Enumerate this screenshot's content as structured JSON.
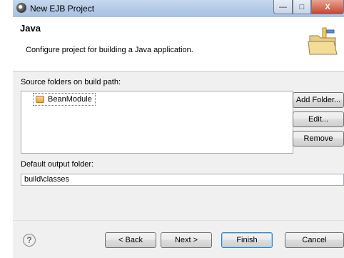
{
  "window": {
    "title": "New EJB Project",
    "controls": {
      "minimize": "—",
      "maximize": "□",
      "close": "X"
    }
  },
  "header": {
    "title": "Java",
    "description": "Configure project for building a Java application."
  },
  "source_folders": {
    "label": "Source folders on build path:",
    "items": [
      "BeanModule"
    ],
    "buttons": {
      "add_folder": "Add Folder...",
      "edit": "Edit...",
      "remove": "Remove"
    }
  },
  "output_folder": {
    "label": "Default output folder:",
    "value": "build\\classes"
  },
  "footer": {
    "help": "?",
    "back": "< Back",
    "next": "Next >",
    "finish": "Finish",
    "cancel": "Cancel"
  },
  "icons": {
    "app": "eclipse-icon",
    "header": "folder-icon",
    "source_item": "package-folder-icon",
    "help": "help-icon"
  }
}
